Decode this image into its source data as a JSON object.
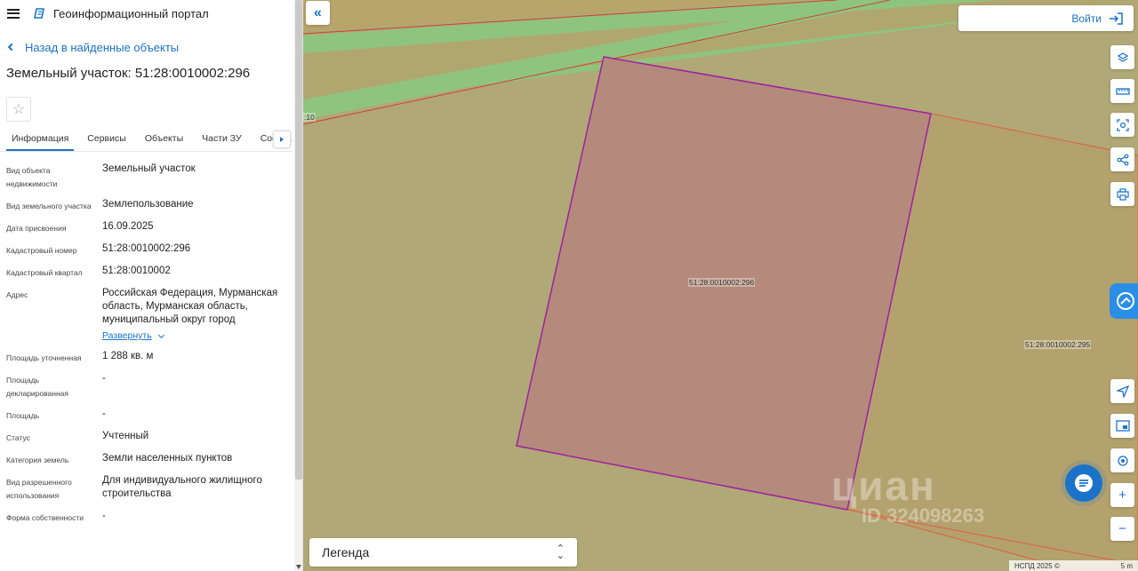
{
  "header": {
    "portal_title": "Геоинформационный портал"
  },
  "back_link": "Назад в найденные объекты",
  "object_title": "Земельный участок: 51:28:0010002:296",
  "tabs": [
    {
      "label": "Информация",
      "active": true
    },
    {
      "label": "Сервисы"
    },
    {
      "label": "Объекты"
    },
    {
      "label": "Части ЗУ"
    },
    {
      "label": "Соста..."
    }
  ],
  "properties": [
    {
      "label": "Вид объекта недвижимости",
      "value": "Земельный участок"
    },
    {
      "label": "Вид земельного участка",
      "value": "Землепользование"
    },
    {
      "label": "Дата присвоения",
      "value": "16.09.2025"
    },
    {
      "label": "Кадастровый номер",
      "value": "51:28:0010002:296"
    },
    {
      "label": "Кадастровый квартал",
      "value": "51:28:0010002"
    },
    {
      "label": "Адрес",
      "value": "Российская Федерация, Мурманская область, Мурманская область, муниципальный округ город"
    },
    {
      "label": "Площадь уточненная",
      "value": "1 288 кв. м"
    },
    {
      "label": "Площадь декларированная",
      "value": "-"
    },
    {
      "label": "Площадь",
      "value": "-"
    },
    {
      "label": "Статус",
      "value": "Учтенный"
    },
    {
      "label": "Категория земель",
      "value": "Земли населенных пунктов"
    },
    {
      "label": "Вид разрешенного использования",
      "value": "Для индивидуального жилищного строительства"
    },
    {
      "label": "Форма собственности",
      "value": "-"
    }
  ],
  "expand_label": "Развернуть",
  "map": {
    "login_label": "Войти",
    "legend_label": "Легенда",
    "parcel_main_label": "51:28:0010002:296",
    "parcel_neighbor_label": "51:28:0010002:295",
    "edge_label": ":10",
    "attribution": "НСПД 2025 ©",
    "scale_label": "5 m",
    "watermark_logo": "циан",
    "watermark_id": "ID 324098263"
  },
  "colors": {
    "accent": "#1a73c8",
    "map_background": "#b0a876",
    "parcel_fill": "#b48a7c",
    "parcel_border": "#a020a0",
    "road_green": "#8fc47e"
  },
  "icons": {
    "menu": "menu-icon",
    "logo": "portal-logo-icon",
    "back": "chevron-left-icon",
    "star": "star-icon",
    "collapse": "double-chevron-left-icon",
    "login": "login-arrow-icon",
    "tools": [
      "layers-icon",
      "ruler-icon",
      "select-area-icon",
      "share-icon",
      "print-icon"
    ],
    "map_controls": [
      "locate-icon",
      "minimap-icon",
      "geolocation-icon",
      "zoom-in-icon",
      "zoom-out-icon"
    ],
    "chat": "chat-icon"
  }
}
